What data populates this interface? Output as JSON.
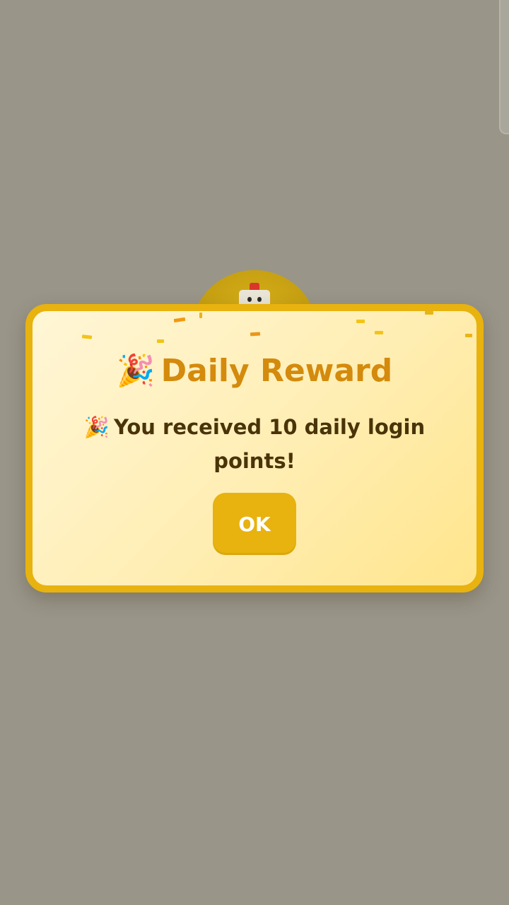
{
  "background": {
    "overlay_color": "#999589",
    "avatar_color": "#c9a214"
  },
  "dialog": {
    "title_icon": "party-popper-icon",
    "title_emoji": "🎉",
    "title": "Daily Reward",
    "message_icon": "party-popper-icon",
    "message_emoji": "🎉",
    "message": "You received 10 daily login points!",
    "ok_label": "OK",
    "colors": {
      "border": "#e8b20f",
      "title": "#d48a0c",
      "message": "#4a3309",
      "button": "#e8b20f",
      "button_text": "#ffffff"
    }
  }
}
